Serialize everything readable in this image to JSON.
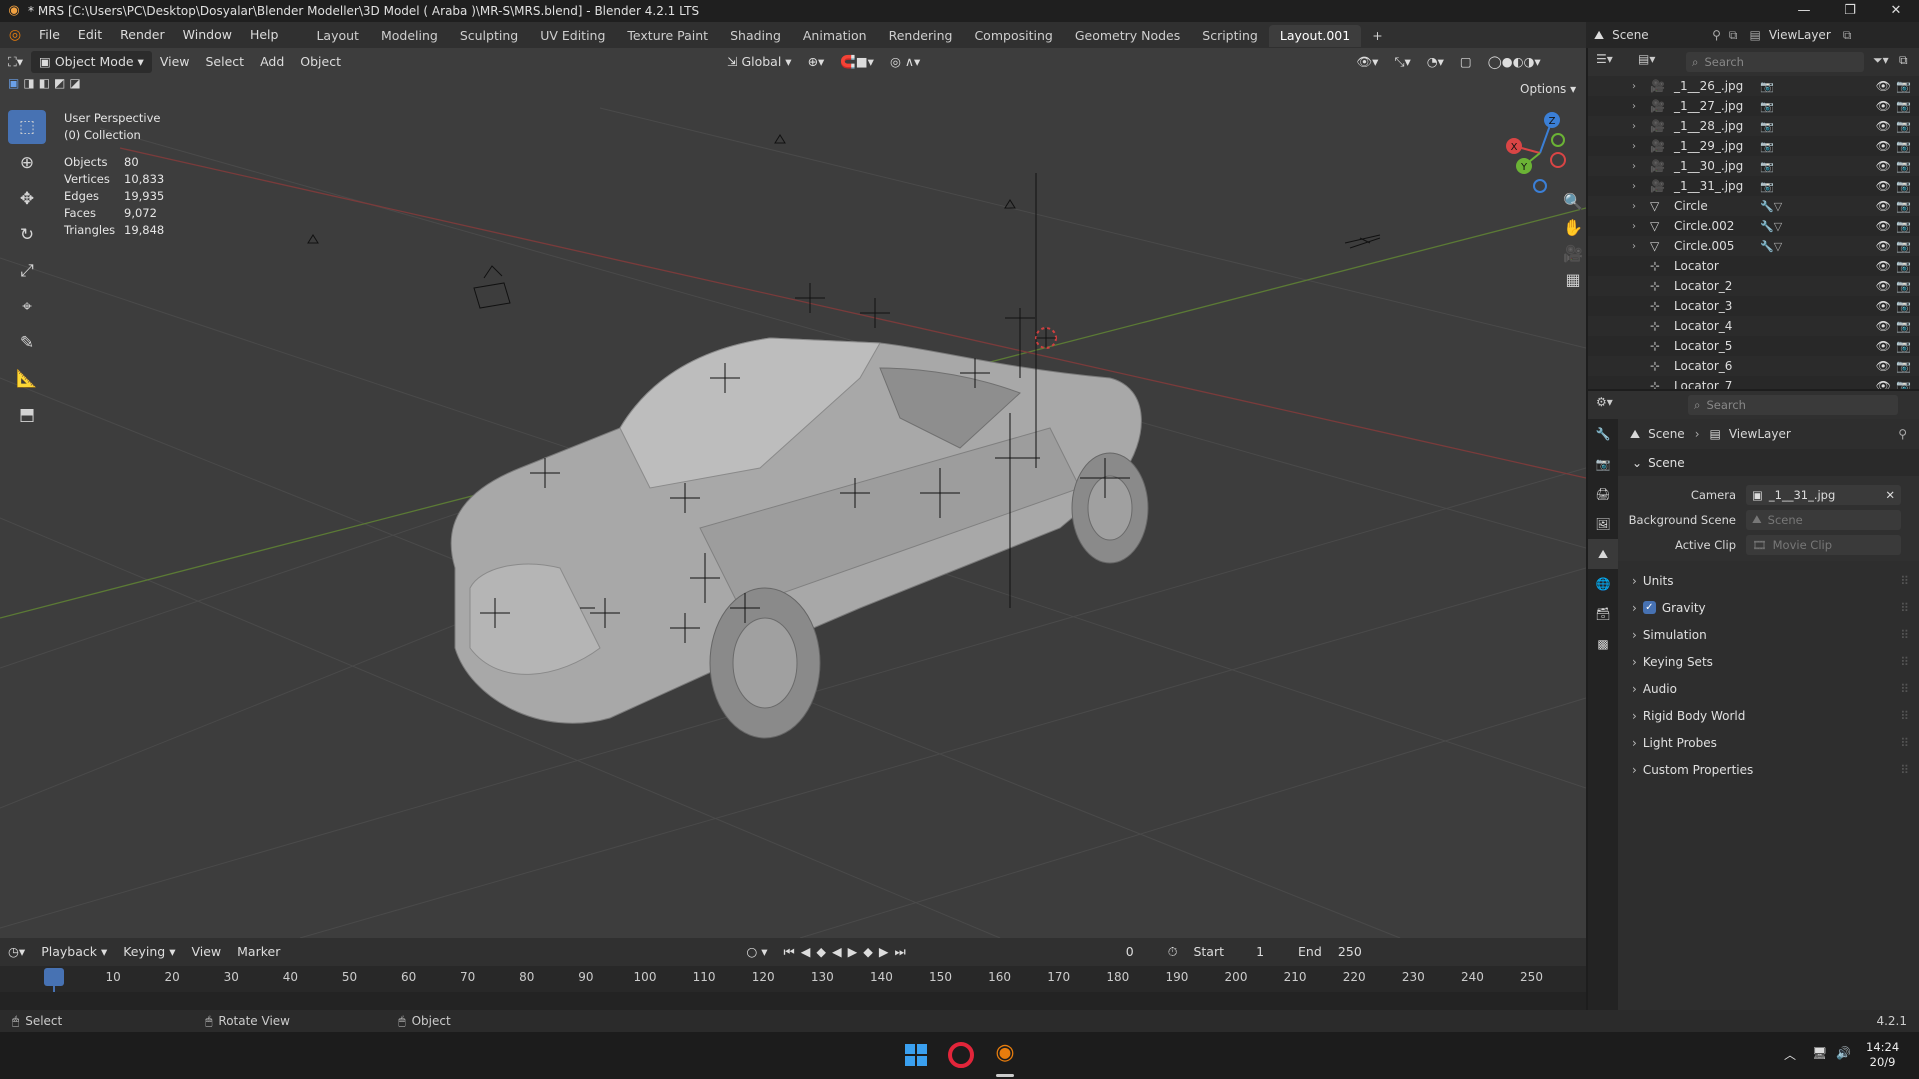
{
  "window": {
    "title": "* MRS [C:\\Users\\PC\\Desktop\\Dosyalar\\Blender Modeller\\3D Model ( Araba )\\MR-S\\MRS.blend] - Blender 4.2.1 LTS",
    "min": "—",
    "max": "❐",
    "close": "✕"
  },
  "menu": [
    "File",
    "Edit",
    "Render",
    "Window",
    "Help"
  ],
  "workspaces": [
    "Layout",
    "Modeling",
    "Sculpting",
    "UV Editing",
    "Texture Paint",
    "Shading",
    "Animation",
    "Rendering",
    "Compositing",
    "Geometry Nodes",
    "Scripting",
    "Layout.001"
  ],
  "active_workspace": "Layout.001",
  "add_workspace": "+",
  "scene_selector": {
    "scene": "Scene",
    "view_layer": "ViewLayer"
  },
  "viewport": {
    "mode": "Object Mode",
    "menus": [
      "View",
      "Select",
      "Add",
      "Object"
    ],
    "orientation": "Global",
    "options": "Options",
    "overlay_title": "User Perspective",
    "overlay_collection": "(0) Collection",
    "stats": [
      {
        "label": "Objects",
        "value": "80"
      },
      {
        "label": "Vertices",
        "value": "10,833"
      },
      {
        "label": "Edges",
        "value": "19,935"
      },
      {
        "label": "Faces",
        "value": "9,072"
      },
      {
        "label": "Triangles",
        "value": "19,848"
      }
    ],
    "gizmo_axes": {
      "x": "X",
      "y": "Y",
      "z": "Z"
    }
  },
  "outliner": {
    "search_placeholder": "Search",
    "items": [
      {
        "name": "_1__26_.jpg",
        "type": "camera"
      },
      {
        "name": "_1__27_.jpg",
        "type": "camera"
      },
      {
        "name": "_1__28_.jpg",
        "type": "camera"
      },
      {
        "name": "_1__29_.jpg",
        "type": "camera"
      },
      {
        "name": "_1__30_.jpg",
        "type": "camera"
      },
      {
        "name": "_1__31_.jpg",
        "type": "camera"
      },
      {
        "name": "Circle",
        "type": "mesh"
      },
      {
        "name": "Circle.002",
        "type": "mesh"
      },
      {
        "name": "Circle.005",
        "type": "mesh"
      },
      {
        "name": "Locator",
        "type": "empty"
      },
      {
        "name": "Locator_2",
        "type": "empty"
      },
      {
        "name": "Locator_3",
        "type": "empty"
      },
      {
        "name": "Locator_4",
        "type": "empty"
      },
      {
        "name": "Locator_5",
        "type": "empty"
      },
      {
        "name": "Locator_6",
        "type": "empty"
      },
      {
        "name": "Locator_7",
        "type": "empty"
      }
    ]
  },
  "properties": {
    "search_placeholder": "Search",
    "breadcrumb": [
      "Scene",
      "ViewLayer"
    ],
    "section": "Scene",
    "camera_label": "Camera",
    "camera_value": "_1__31_.jpg",
    "bg_scene_label": "Background Scene",
    "bg_scene_placeholder": "Scene",
    "active_clip_label": "Active Clip",
    "active_clip_placeholder": "Movie Clip",
    "panels": [
      "Units",
      "Gravity",
      "Simulation",
      "Keying Sets",
      "Audio",
      "Rigid Body World",
      "Light Probes",
      "Custom Properties"
    ],
    "gravity_checked": true
  },
  "timeline": {
    "menus": [
      "Playback",
      "Keying",
      "View",
      "Marker"
    ],
    "current_frame": "0",
    "start_label": "Start",
    "start": "1",
    "end_label": "End",
    "end": "250",
    "ticks": [
      "0",
      "10",
      "20",
      "30",
      "40",
      "50",
      "60",
      "70",
      "80",
      "90",
      "100",
      "110",
      "120",
      "130",
      "140",
      "150",
      "160",
      "170",
      "180",
      "190",
      "200",
      "210",
      "220",
      "230",
      "240",
      "250"
    ]
  },
  "statusbar": {
    "select": "Select",
    "rotate": "Rotate View",
    "object": "Object",
    "version": "4.2.1"
  },
  "taskbar": {
    "time": "14:24",
    "date": "20/9"
  },
  "colors": {
    "accent": "#4772b3",
    "viewport_bg": "#3d3d3d",
    "frame_marker": "#4772b3"
  }
}
